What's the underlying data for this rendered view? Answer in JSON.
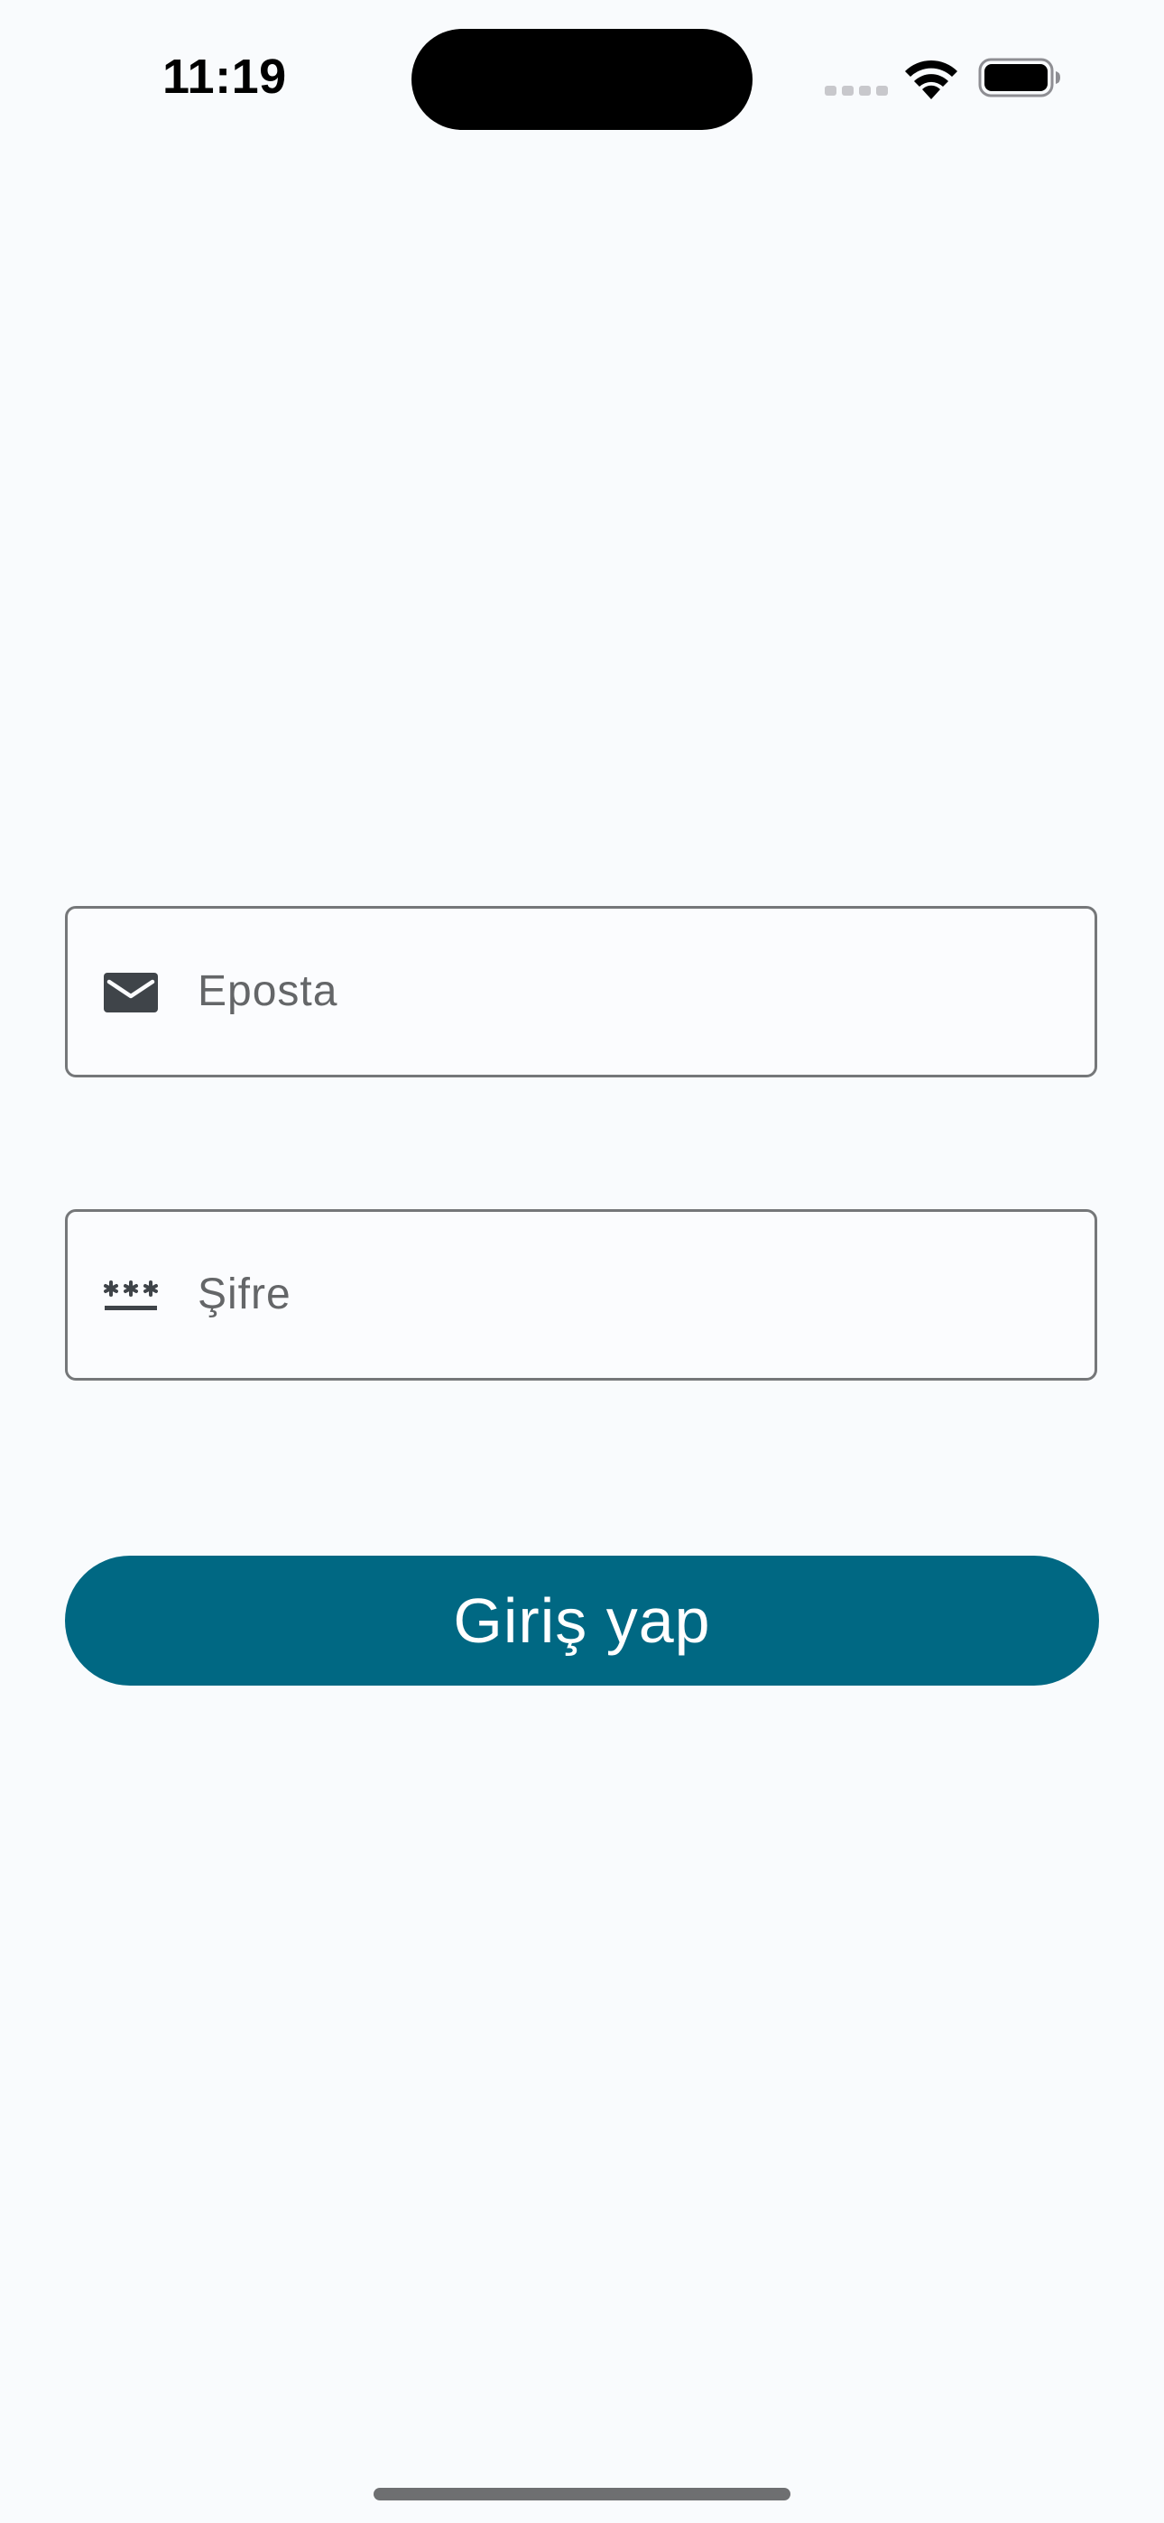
{
  "status_bar": {
    "time": "11:19",
    "icons": [
      "cellular-signal-icon",
      "wifi-icon",
      "battery-icon"
    ]
  },
  "login_form": {
    "email": {
      "placeholder": "Eposta",
      "icon": "envelope-icon"
    },
    "password": {
      "placeholder": "Şifre",
      "icon": "password-icon"
    },
    "submit_label": "Giriş yap"
  },
  "colors": {
    "background": "#f9fbfd",
    "button": "#006883",
    "field_border": "#757779",
    "placeholder_text": "#646668",
    "icon": "#3f4449"
  }
}
